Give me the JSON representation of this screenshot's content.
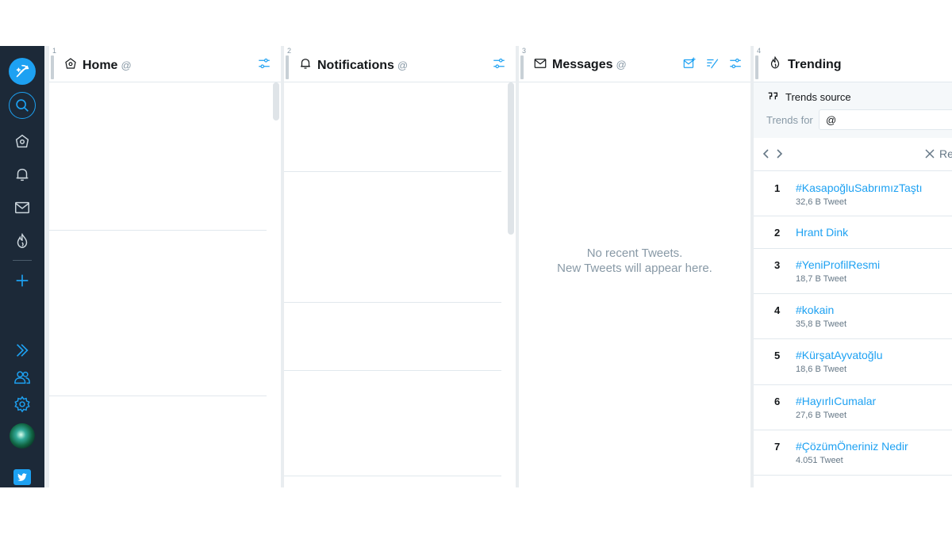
{
  "sidebar": {
    "icons": [
      "compose-icon",
      "search-icon",
      "home-icon",
      "notifications-icon",
      "messages-icon",
      "trending-icon",
      "add-column-icon",
      "expand-icon",
      "accounts-icon",
      "settings-icon"
    ]
  },
  "columns": [
    {
      "number": "1",
      "title": "Home",
      "handle": "@"
    },
    {
      "number": "2",
      "title": "Notifications",
      "handle": "@"
    },
    {
      "number": "3",
      "title": "Messages",
      "handle": "@"
    },
    {
      "number": "4",
      "title": "Trending",
      "handle": ""
    }
  ],
  "messages": {
    "empty_line1": "No recent Tweets.",
    "empty_line2": "New Tweets will appear here."
  },
  "trending": {
    "source_label": "Trends source",
    "for_label": "Trends for",
    "for_value": "@",
    "remove_label": "Re",
    "items": [
      {
        "rank": "1",
        "name": "#KasapoğluSabrımızTaştı",
        "count": "32,6 B Tweet"
      },
      {
        "rank": "2",
        "name": "Hrant Dink",
        "count": ""
      },
      {
        "rank": "3",
        "name": "#YeniProfilResmi",
        "count": "18,7 B Tweet"
      },
      {
        "rank": "4",
        "name": "#kokain",
        "count": "35,8 B Tweet"
      },
      {
        "rank": "5",
        "name": "#KürşatAyvatoğlu",
        "count": "18,6 B Tweet"
      },
      {
        "rank": "6",
        "name": "#HayırlıCumalar",
        "count": "27,6 B Tweet"
      },
      {
        "rank": "7",
        "name": "#ÇözümÖneriniz Nedir",
        "count": "4.051 Tweet"
      }
    ]
  },
  "colors": {
    "accent": "#1da1f2",
    "sidebar": "#1c2938",
    "muted": "#8899a6"
  }
}
